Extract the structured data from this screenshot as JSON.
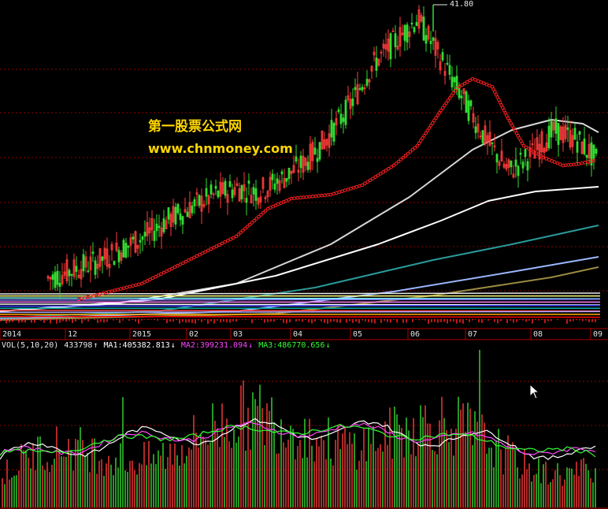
{
  "watermark": {
    "title": "第一股票公式网",
    "url": "www.chnmoney.com"
  },
  "price_panel": {
    "peak_label": "41.80"
  },
  "x_axis": {
    "labels": [
      "2014",
      "12",
      "2015",
      "02",
      "03",
      "04",
      "05",
      "06",
      "07",
      "08",
      "09"
    ]
  },
  "volume_panel": {
    "indicator_name": "VOL(5,10,20)",
    "current_value": "433798",
    "ma1_label": "MA1:405382.813",
    "ma2_label": "MA2:399231.094",
    "ma3_label": "MA3:486770.656",
    "arrow_up": "↑",
    "arrow_down": "↓"
  },
  "colors": {
    "up": "#ff3b3b",
    "down": "#33dd33",
    "grid": "#8b0000",
    "ma1": "#ffffff",
    "ma2": "#ff44ff",
    "ma3": "#33ff33",
    "sar": "#ff2020"
  },
  "chart_data": [
    {
      "type": "candlestick",
      "title": "",
      "x_labels": [
        "2014",
        "12",
        "2015",
        "02",
        "03",
        "04",
        "05",
        "06",
        "07",
        "08",
        "09"
      ],
      "annotations": [
        "41.80"
      ],
      "price_series": [
        9,
        9.5,
        10,
        11,
        12,
        13.5,
        15,
        17,
        18.5,
        20,
        21,
        20.5,
        22,
        24,
        27,
        31,
        36,
        39,
        41.8,
        37,
        32,
        27,
        23,
        25,
        28,
        27,
        24
      ],
      "overlays": [
        "SAR",
        "long moving averages"
      ]
    },
    {
      "type": "bar",
      "title": "VOL(5,10,20)",
      "series": [
        {
          "name": "MA1",
          "value": 405382.813
        },
        {
          "name": "MA2",
          "value": 399231.094
        },
        {
          "name": "MA3",
          "value": 486770.656
        }
      ],
      "current": 433798
    }
  ]
}
